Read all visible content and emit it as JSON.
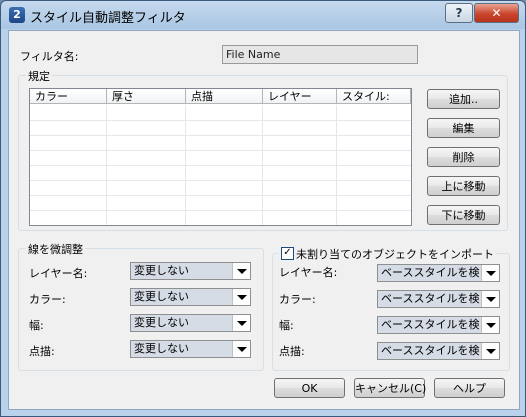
{
  "window": {
    "title": "スタイル自動調整フィルタ",
    "app_icon": "2"
  },
  "titlebar": {
    "help_label": "?",
    "close_label": "✕"
  },
  "filter_name": {
    "label": "フィルタ名:",
    "value": "File Name"
  },
  "rules": {
    "group_title": "規定",
    "columns": [
      "カラー",
      "厚さ",
      "点描",
      "レイヤー",
      "スタイル:"
    ],
    "buttons": {
      "add": "追加..",
      "edit": "編集",
      "delete": "削除",
      "move_up": "上に移動",
      "move_down": "下に移動"
    }
  },
  "fine_tune": {
    "group_title": "線を微調整",
    "rows": [
      {
        "label": "レイヤー名:",
        "value": "変更しない"
      },
      {
        "label": "カラー:",
        "value": "変更しない"
      },
      {
        "label": "幅:",
        "value": "変更しない"
      },
      {
        "label": "点描:",
        "value": "変更しない"
      }
    ]
  },
  "import_unassigned": {
    "checked": true,
    "check_mark": "✓",
    "group_title": "未割り当てのオブジェクトをインポート",
    "rows": [
      {
        "label": "レイヤー名:",
        "value": "ベーススタイルを検索:"
      },
      {
        "label": "カラー:",
        "value": "ベーススタイルを検索:"
      },
      {
        "label": "幅:",
        "value": "ベーススタイルを検索:"
      },
      {
        "label": "点描:",
        "value": "ベーススタイルを検索:"
      }
    ]
  },
  "footer": {
    "ok": "OK",
    "cancel": "キャンセル(C)",
    "help": "ヘルプ"
  },
  "icons": {
    "app": "app-icon",
    "help": "help-icon",
    "close": "close-icon",
    "dropdown": "chevron-down-icon"
  }
}
